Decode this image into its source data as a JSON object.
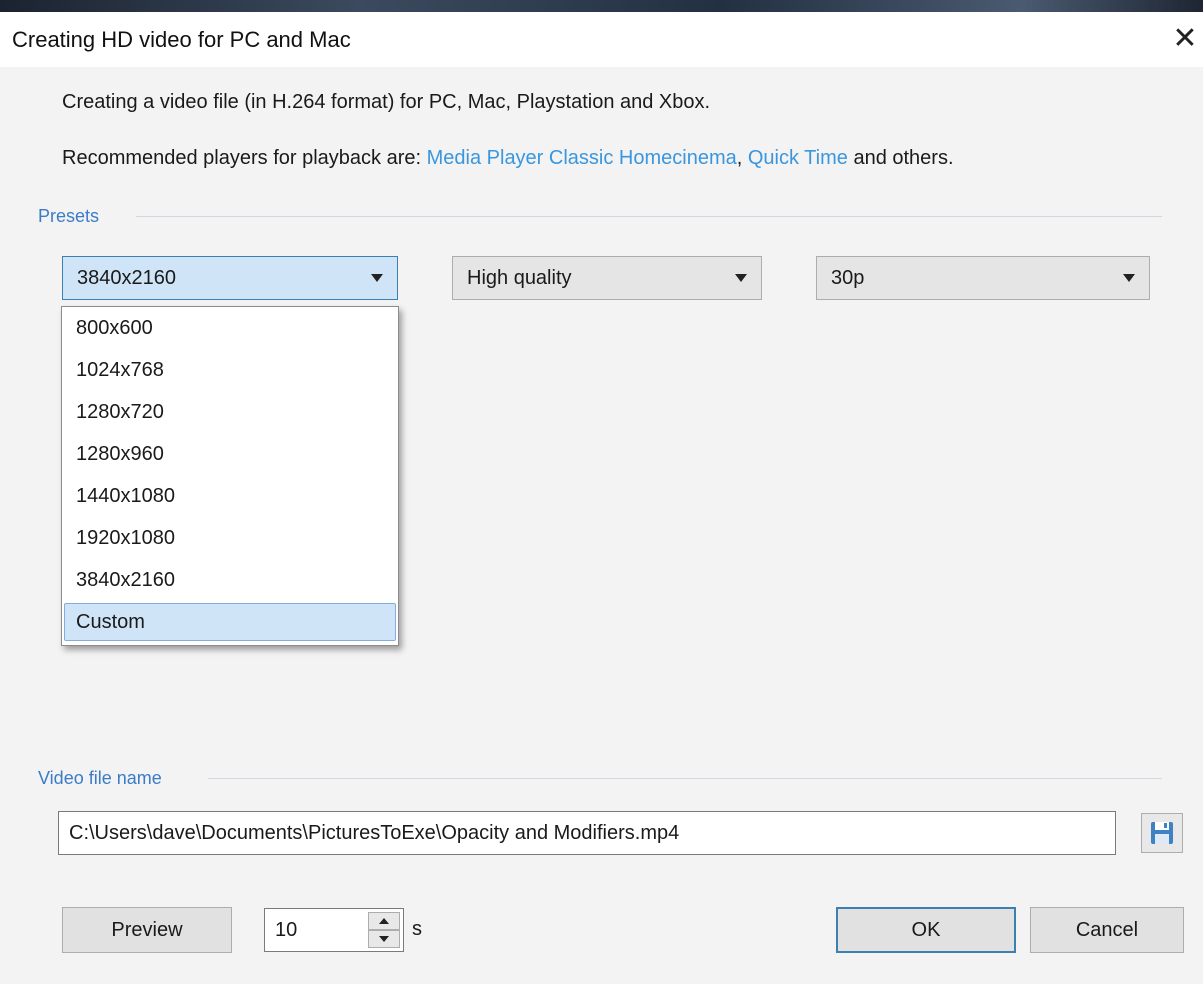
{
  "window": {
    "title": "Creating HD video for PC and Mac",
    "close_glyph": "✕"
  },
  "intro": {
    "line1": "Creating a video file (in H.264 format) for PC, Mac, Playstation and Xbox.",
    "line2_prefix": "Recommended players for playback are: ",
    "link1": "Media Player Classic Homecinema",
    "separator": ", ",
    "link2": "Quick Time",
    "line2_suffix": " and others."
  },
  "presets": {
    "label": "Presets",
    "resolution": "3840x2160",
    "quality": "High quality",
    "framerate": "30p",
    "resolution_options": [
      "800x600",
      "1024x768",
      "1280x720",
      "1280x960",
      "1440x1080",
      "1920x1080",
      "3840x2160",
      "Custom"
    ],
    "highlighted_option": "Custom"
  },
  "video_file": {
    "label": "Video file name",
    "path": "C:\\Users\\dave\\Documents\\PicturesToExe\\Opacity and Modifiers.mp4",
    "save_icon": "floppy-disk-icon"
  },
  "footer": {
    "preview_label": "Preview",
    "duration_value": "10",
    "duration_unit": "s",
    "ok_label": "OK",
    "cancel_label": "Cancel"
  },
  "colors": {
    "link": "#3a96dd",
    "section_label": "#3a7cc8",
    "accent_border": "#3c7fb1",
    "highlight_bg": "#cfe4f7"
  }
}
